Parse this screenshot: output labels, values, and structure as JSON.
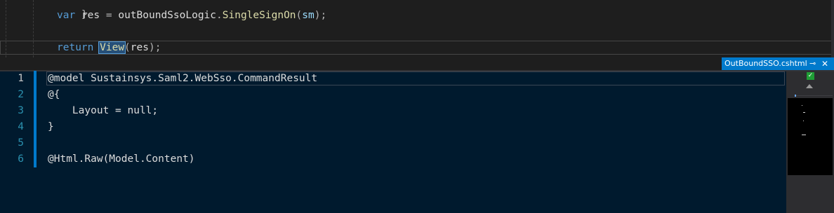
{
  "top_editor": {
    "lines": [
      {
        "brace": "}"
      },
      {
        "kw": "var",
        "name": "res",
        "eq": " = ",
        "obj": "outBoundSsoLogic",
        "dot": ".",
        "method": "SingleSignOn",
        "open": "(",
        "arg": "sm",
        "close": ");"
      },
      {
        "kw": "return",
        "method": "View",
        "open": "(",
        "arg": "res",
        "close": ");"
      }
    ]
  },
  "tab": {
    "filename": "OutBoundSSO.cshtml",
    "pin_glyph": "⊸",
    "close_glyph": "✕"
  },
  "bottom_editor": {
    "line_numbers": [
      "1",
      "2",
      "3",
      "4",
      "5",
      "6"
    ],
    "active_line": 1,
    "lines": [
      "@model Sustainsys.Saml2.WebSso.CommandResult",
      "@{",
      "    Layout = null;",
      "}",
      "",
      "@Html.Raw(Model.Content)"
    ]
  },
  "right_rail": {
    "status_glyph": "✓"
  },
  "colors": {
    "accent": "#007acc",
    "keyword": "#569cd6",
    "method": "#dcdcaa",
    "parameter": "#9cdcfe",
    "line_number": "#2b91af",
    "editor_bg_top": "#1e1e1e",
    "editor_bg_bottom": "#001a2e"
  }
}
